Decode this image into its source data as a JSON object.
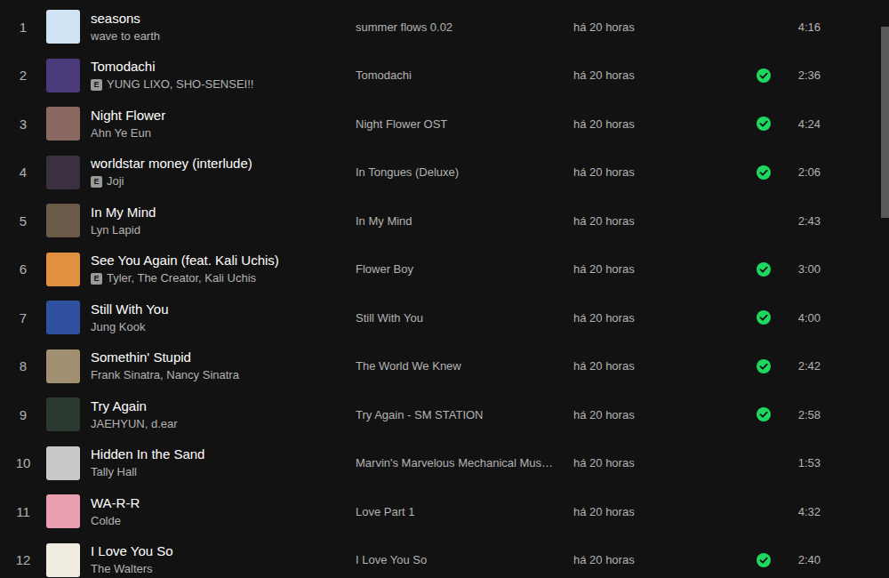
{
  "explicit_badge": "E",
  "table": {
    "rows": [
      {
        "index": "1",
        "title": "seasons",
        "explicit": false,
        "artists": "wave to earth",
        "album": "summer flows 0.02",
        "added": "há 20 horas",
        "saved": false,
        "duration": "4:16",
        "color": "#cfe3f5"
      },
      {
        "index": "2",
        "title": "Tomodachi",
        "explicit": true,
        "artists": "YUNG LIXO, SHO-SENSEI!!",
        "album": "Tomodachi",
        "added": "há 20 horas",
        "saved": true,
        "duration": "2:36",
        "color": "#4a3a7a"
      },
      {
        "index": "3",
        "title": "Night Flower",
        "explicit": false,
        "artists": "Ahn Ye Eun",
        "album": "Night Flower OST",
        "added": "há 20 horas",
        "saved": true,
        "duration": "4:24",
        "color": "#8a6a60"
      },
      {
        "index": "4",
        "title": "worldstar money (interlude)",
        "explicit": true,
        "artists": "Joji",
        "album": "In Tongues (Deluxe)",
        "added": "há 20 horas",
        "saved": true,
        "duration": "2:06",
        "color": "#3a3040"
      },
      {
        "index": "5",
        "title": "In My Mind",
        "explicit": false,
        "artists": "Lyn Lapid",
        "album": "In My Mind",
        "added": "há 20 horas",
        "saved": false,
        "duration": "2:43",
        "color": "#6a5a48"
      },
      {
        "index": "6",
        "title": "See You Again (feat. Kali Uchis)",
        "explicit": true,
        "artists": "Tyler, The Creator, Kali Uchis",
        "album": "Flower Boy",
        "added": "há 20 horas",
        "saved": true,
        "duration": "3:00",
        "color": "#e09040"
      },
      {
        "index": "7",
        "title": "Still With You",
        "explicit": false,
        "artists": "Jung Kook",
        "album": "Still With You",
        "added": "há 20 horas",
        "saved": true,
        "duration": "4:00",
        "color": "#3050a0"
      },
      {
        "index": "8",
        "title": "Somethin' Stupid",
        "explicit": false,
        "artists": "Frank Sinatra, Nancy Sinatra",
        "album": "The World We Knew",
        "added": "há 20 horas",
        "saved": true,
        "duration": "2:42",
        "color": "#a09070"
      },
      {
        "index": "9",
        "title": "Try Again",
        "explicit": false,
        "artists": "JAEHYUN, d.ear",
        "album": "Try Again - SM STATION",
        "added": "há 20 horas",
        "saved": true,
        "duration": "2:58",
        "color": "#2a3a30"
      },
      {
        "index": "10",
        "title": "Hidden In the Sand",
        "explicit": false,
        "artists": "Tally Hall",
        "album": "Marvin's Marvelous Mechanical Mus…",
        "added": "há 20 horas",
        "saved": false,
        "duration": "1:53",
        "color": "#c8c8c8"
      },
      {
        "index": "11",
        "title": "WA-R-R",
        "explicit": false,
        "artists": "Colde",
        "album": "Love Part 1",
        "added": "há 20 horas",
        "saved": false,
        "duration": "4:32",
        "color": "#e8a0b0"
      },
      {
        "index": "12",
        "title": "I Love You So",
        "explicit": false,
        "artists": "The Walters",
        "album": "I Love You So",
        "added": "há 20 horas",
        "saved": true,
        "duration": "2:40",
        "color": "#f0ece0"
      }
    ]
  },
  "scrollbar": {
    "level": 0.33
  }
}
